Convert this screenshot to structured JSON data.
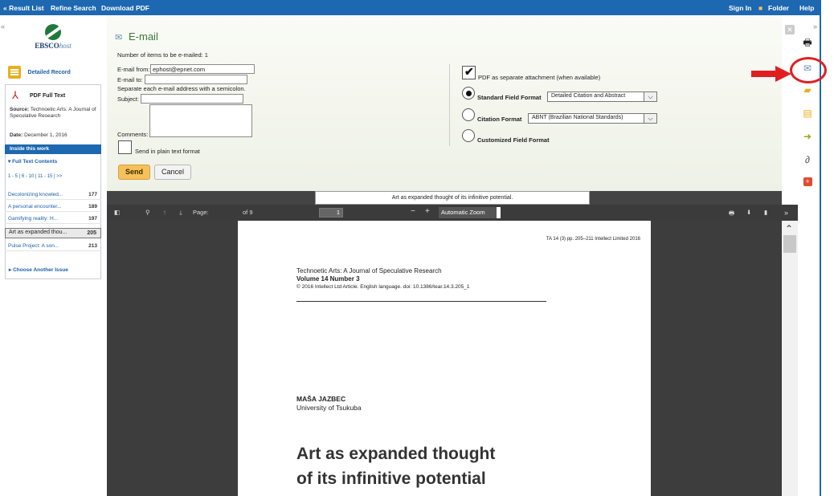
{
  "topbar": {
    "result_list": "« Result List",
    "refine_search": "Refine Search",
    "download_pdf": "Download PDF",
    "sign_in": "Sign In",
    "folder": "Folder",
    "help": "Help"
  },
  "sidebar": {
    "logo_main": "EBSCO",
    "logo_sub": "host",
    "detailed_record": "Detailed Record",
    "pdf_full_text": "PDF Full Text",
    "source_label": "Source:",
    "source_value": "Technoetic Arts: A Journal of Speculative Research",
    "date_label": "Date:",
    "date_value": "December 1, 2016",
    "inside_this_work": "Inside this work",
    "full_text_contents": "Full Text Contents",
    "pager": "1 - 5 | 6 - 10 | 11 - 15 | >>",
    "toc": [
      {
        "title": "Decolonizing knowled...",
        "page": "177"
      },
      {
        "title": "A personal encounter...",
        "page": "189"
      },
      {
        "title": "Gamifying reality: H...",
        "page": "197"
      },
      {
        "title": "Art as expanded thou...",
        "page": "205"
      },
      {
        "title": "Pulse Project: A son...",
        "page": "213"
      }
    ],
    "choose_another_issue": "Choose Another Issue"
  },
  "email": {
    "title": "E-mail",
    "items_count": "Number of items to be e-mailed: 1",
    "from_label": "E-mail from:",
    "from_value": "ephost@epnet.com",
    "to_label": "E-mail to:",
    "separator_note": "Separate each e-mail address with a semicolon.",
    "subject_label": "Subject:",
    "comments_label": "Comments:",
    "plain_text_label": "Send in plain text format",
    "send_label": "Send",
    "cancel_label": "Cancel",
    "pdf_attachment_label": "PDF as separate attachment (when available)",
    "standard_format_label": "Standard Field Format",
    "standard_format_value": "Detailed Citation and Abstract",
    "citation_format_label": "Citation Format",
    "citation_format_value": "ABNT (Brazilian National Standards)",
    "custom_format_label": "Customized Field Format"
  },
  "viewer": {
    "tab_title": "Art as expanded thought of its infinitive potential.",
    "page_label": "Page:",
    "page_value": "1",
    "page_of": "of 9",
    "zoom_value": "Automatic Zoom"
  },
  "pdf": {
    "meta": "TA 14 (3) pp. 205–211  Intellect Limited 2016",
    "journal": "Technoetic Arts: A Journal of Speculative Research",
    "volume": "Volume 14 Number 3",
    "copyright": "© 2016 Intellect Ltd Article. English language. doi: 10.1386/tear.14.3.205_1",
    "author": "MAŠA JAZBEC",
    "affiliation": "University of Tsukuba",
    "heading_line1": "Art as expanded thought",
    "heading_line2": "of its infinitive potential"
  },
  "colors": {
    "brand": "#1d68b0",
    "accent": "#f6c15a",
    "highlight": "#e02020"
  }
}
